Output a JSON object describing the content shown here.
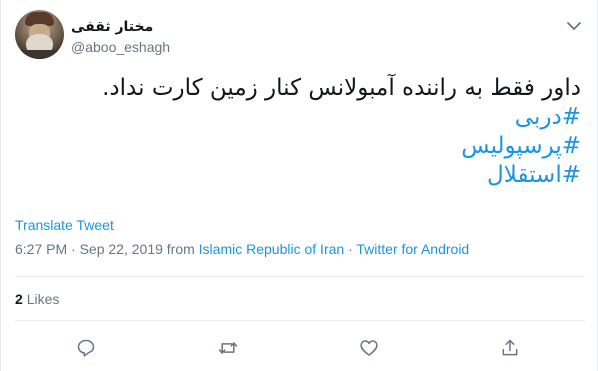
{
  "tweet": {
    "author_name": "مختار ثقفی",
    "handle": "@aboo_eshagh",
    "text": "داور فقط به راننده آمبولانس کنار زمین کارت نداد.",
    "hashtags": [
      "#دربی",
      "#پرسپولیس",
      "#استقلال"
    ],
    "translate_label": "Translate Tweet",
    "time": "6:27 PM",
    "date": "Sep 22, 2019",
    "from_word": "from",
    "location": "Islamic Republic of Iran",
    "separator": "·",
    "source": "Twitter for Android",
    "like_count": "2",
    "like_label": "Likes"
  },
  "icons": {
    "menu": "chevron-down-icon",
    "reply": "reply-icon",
    "retweet": "retweet-icon",
    "like": "heart-icon",
    "share": "share-icon"
  },
  "colors": {
    "accent": "#1b95e0",
    "secondary_text": "#657786",
    "primary_text": "#14171a",
    "divider": "#e6ecf0"
  }
}
